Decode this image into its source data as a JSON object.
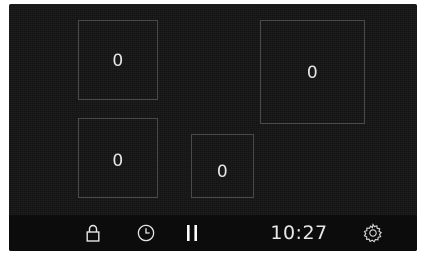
{
  "zones": [
    {
      "id": "zone-1",
      "value": "0"
    },
    {
      "id": "zone-2",
      "value": "0"
    },
    {
      "id": "zone-3",
      "value": "0"
    },
    {
      "id": "zone-4",
      "value": "0"
    }
  ],
  "bottom_bar": {
    "lock_icon": "lock-icon",
    "timer_icon": "timer-icon",
    "pause_icon": "pause-icon",
    "time": "10:27",
    "settings_icon": "gear-icon"
  },
  "colors": {
    "background": "#141414",
    "bar_background": "#0c0c0c",
    "zone_border": "#4a4a4a",
    "text": "#e6e6e6"
  }
}
